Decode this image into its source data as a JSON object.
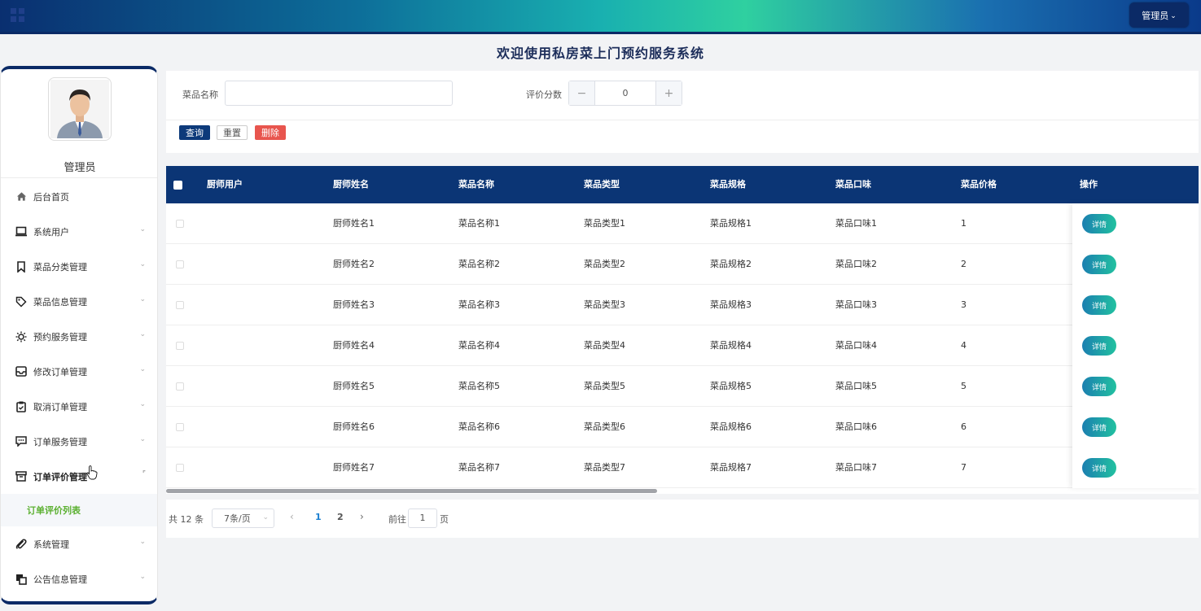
{
  "header": {
    "admin_button_label": "管理员",
    "chevron": "⌄"
  },
  "page_title": "欢迎使用私房菜上门预约服务系统",
  "sidebar": {
    "username": "管理员",
    "items": [
      {
        "label": "后台首页",
        "icon": "home-icon"
      },
      {
        "label": "系统用户",
        "icon": "laptop-icon"
      },
      {
        "label": "菜品分类管理",
        "icon": "bookmark-icon"
      },
      {
        "label": "菜品信息管理",
        "icon": "tag-icon"
      },
      {
        "label": "预约服务管理",
        "icon": "sun-icon"
      },
      {
        "label": "修改订单管理",
        "icon": "inbox-icon"
      },
      {
        "label": "取消订单管理",
        "icon": "clipboard-icon"
      },
      {
        "label": "订单服务管理",
        "icon": "chat-icon"
      },
      {
        "label": "订单评价管理",
        "icon": "archive-icon"
      },
      {
        "label": "系统管理",
        "icon": "paperclip-icon"
      },
      {
        "label": "公告信息管理",
        "icon": "copy-icon"
      }
    ],
    "active_submenu": "订单评价列表"
  },
  "search": {
    "dish_name_label": "菜品名称",
    "dish_name_value": "",
    "rating_label": "评价分数",
    "rating_value": "0",
    "minus": "−",
    "plus": "+",
    "query_button": "查询",
    "reset_button": "重置",
    "delete_button": "删除"
  },
  "table": {
    "columns": [
      "厨师用户",
      "厨师姓名",
      "菜品名称",
      "菜品类型",
      "菜品规格",
      "菜品口味",
      "菜品价格",
      "操作"
    ],
    "rows": [
      {
        "chef_user": "",
        "chef_name": "厨师姓名1",
        "dish_name": "菜品名称1",
        "dish_type": "菜品类型1",
        "dish_spec": "菜品规格1",
        "dish_flavor": "菜品口味1",
        "price": "1"
      },
      {
        "chef_user": "",
        "chef_name": "厨师姓名2",
        "dish_name": "菜品名称2",
        "dish_type": "菜品类型2",
        "dish_spec": "菜品规格2",
        "dish_flavor": "菜品口味2",
        "price": "2"
      },
      {
        "chef_user": "",
        "chef_name": "厨师姓名3",
        "dish_name": "菜品名称3",
        "dish_type": "菜品类型3",
        "dish_spec": "菜品规格3",
        "dish_flavor": "菜品口味3",
        "price": "3"
      },
      {
        "chef_user": "",
        "chef_name": "厨师姓名4",
        "dish_name": "菜品名称4",
        "dish_type": "菜品类型4",
        "dish_spec": "菜品规格4",
        "dish_flavor": "菜品口味4",
        "price": "4"
      },
      {
        "chef_user": "",
        "chef_name": "厨师姓名5",
        "dish_name": "菜品名称5",
        "dish_type": "菜品类型5",
        "dish_spec": "菜品规格5",
        "dish_flavor": "菜品口味5",
        "price": "5"
      },
      {
        "chef_user": "",
        "chef_name": "厨师姓名6",
        "dish_name": "菜品名称6",
        "dish_type": "菜品类型6",
        "dish_spec": "菜品规格6",
        "dish_flavor": "菜品口味6",
        "price": "6"
      },
      {
        "chef_user": "",
        "chef_name": "厨师姓名7",
        "dish_name": "菜品名称7",
        "dish_type": "菜品类型7",
        "dish_spec": "菜品规格7",
        "dish_flavor": "菜品口味7",
        "price": "7"
      }
    ],
    "detail_button": "详情"
  },
  "pagination": {
    "total": "共 12 条",
    "page_size": "7条/页",
    "pages": [
      "1",
      "2"
    ],
    "current_page": "1",
    "goto_label": "前往",
    "goto_value": "1",
    "page_suffix": "页"
  },
  "colors": {
    "primary": "#0b3575",
    "active_submenu": "#5bb030",
    "delete": "#e8554e"
  }
}
